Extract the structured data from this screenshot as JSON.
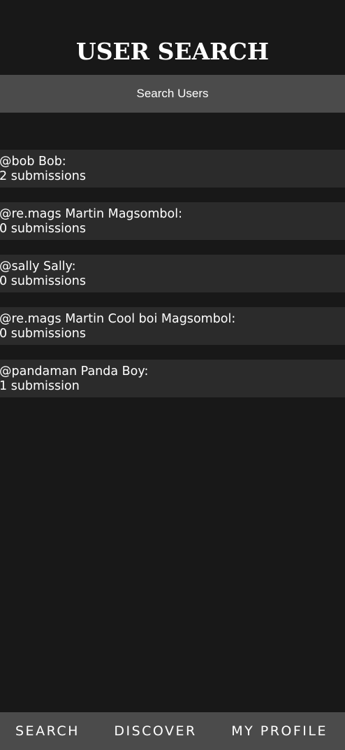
{
  "header": {
    "title": "USER SEARCH"
  },
  "search": {
    "button_label": "Search Users"
  },
  "users": [
    {
      "handle_line": "@bob Bob:",
      "submissions": "2 submissions"
    },
    {
      "handle_line": "@re.mags Martin Magsombol:",
      "submissions": "0 submissions"
    },
    {
      "handle_line": "@sally Sally:",
      "submissions": "0 submissions"
    },
    {
      "handle_line": "@re.mags Martin Cool boi Magsombol:",
      "submissions": "0 submissions"
    },
    {
      "handle_line": "@pandaman Panda Boy:",
      "submissions": "1 submission"
    }
  ],
  "nav": {
    "search": "SEARCH",
    "discover": "DISCOVER",
    "profile": "MY PROFILE"
  },
  "colors": {
    "background": "#181818",
    "button": "#4b4b4b",
    "card": "#2b2b2b",
    "text": "#ffffff"
  }
}
